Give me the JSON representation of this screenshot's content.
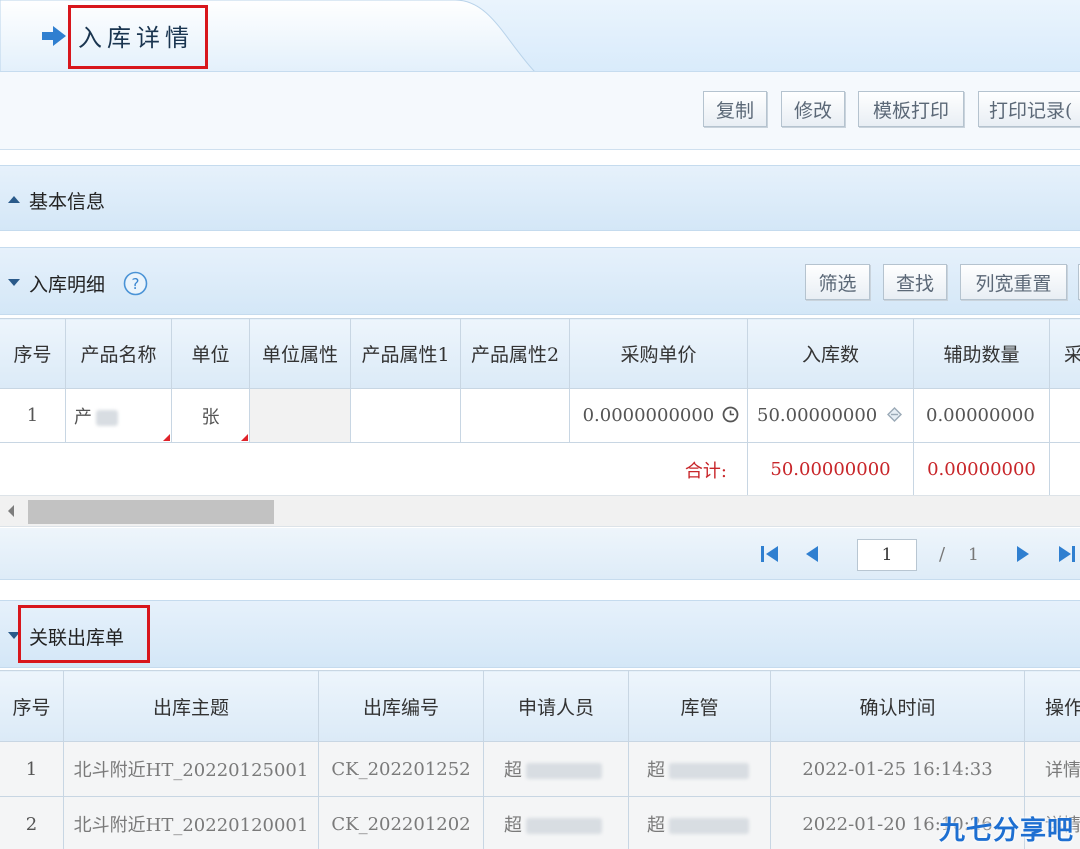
{
  "header": {
    "title": "入库详情"
  },
  "toolbar": {
    "copy": "复制",
    "edit": "修改",
    "template_print": "模板打印",
    "print_log": "打印记录("
  },
  "basic_info": {
    "title": "基本信息"
  },
  "detail": {
    "title": "入库明细",
    "buttons": {
      "filter": "筛选",
      "search": "查找",
      "reset_width": "列宽重置"
    },
    "columns": [
      "序号",
      "产品名称",
      "单位",
      "单位属性",
      "产品属性1",
      "产品属性2",
      "采购单价",
      "入库数",
      "辅助数量",
      "采"
    ],
    "rows": [
      {
        "index": "1",
        "product": "产",
        "unit": "张",
        "unit_attr": "",
        "attr1": "",
        "attr2": "",
        "price": "0.0000000000",
        "qty": "50.00000000",
        "aux_qty": "0.00000000"
      }
    ],
    "total_label": "合计:",
    "total_qty": "50.00000000",
    "total_aux": "0.00000000"
  },
  "pager": {
    "current_page": "1",
    "separator": "/",
    "total_pages": "1"
  },
  "outbound": {
    "title": "关联出库单",
    "columns": [
      "序号",
      "出库主题",
      "出库编号",
      "申请人员",
      "库管",
      "确认时间",
      "操作"
    ],
    "rows": [
      {
        "index": "1",
        "subject": "北斗附近HT_20220125001",
        "code": "CK_202201252",
        "applicant": "超",
        "keeper": "超",
        "time": "2022-01-25 16:14:33",
        "action": "详情"
      },
      {
        "index": "2",
        "subject": "北斗附近HT_20220120001",
        "code": "CK_202201202",
        "applicant": "超",
        "keeper": "超",
        "time": "2022-01-20 16:10:26",
        "action": "详情"
      }
    ]
  },
  "watermark": "九七分享吧",
  "colors": {
    "highlight_red": "#d8161c",
    "accent_blue": "#2f7fd0",
    "total_red": "#c8262a"
  }
}
